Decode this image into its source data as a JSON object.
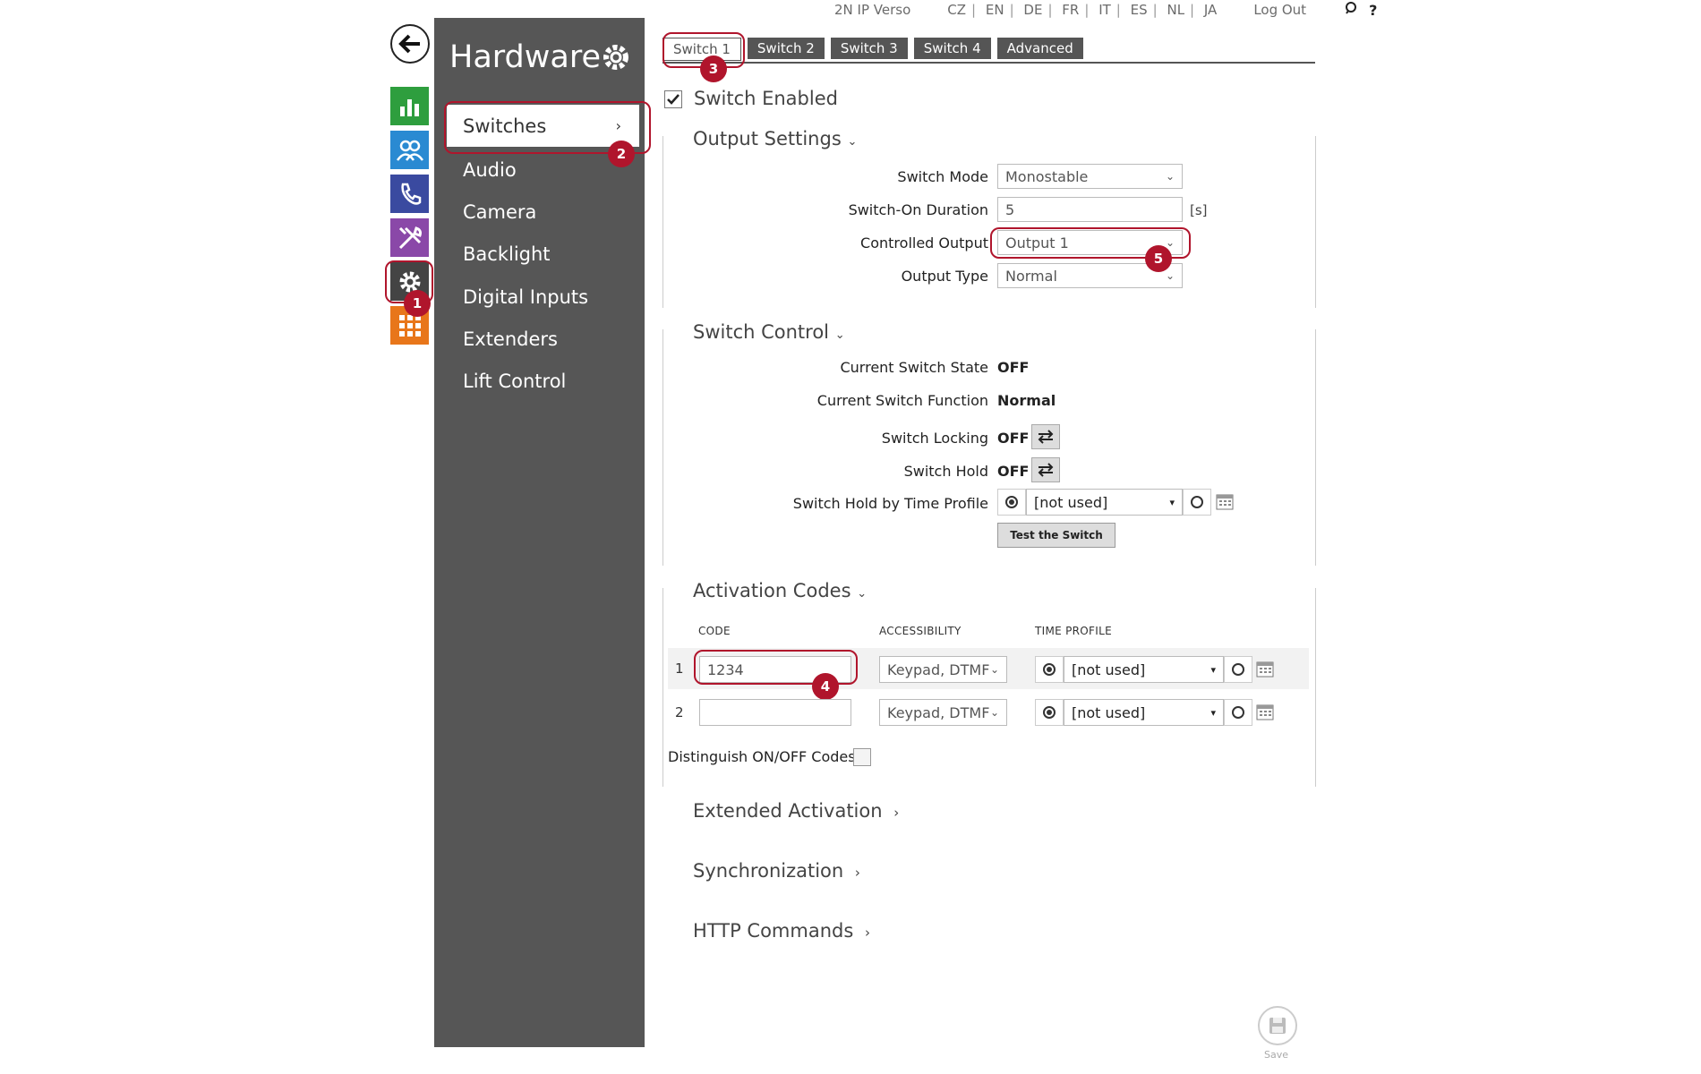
{
  "topbar": {
    "product": "2N IP Verso",
    "languages": [
      "CZ",
      "EN",
      "DE",
      "FR",
      "IT",
      "ES",
      "NL",
      "JA"
    ],
    "logout": "Log Out",
    "search_icon": "search-icon",
    "help": "?"
  },
  "nav_icons": [
    {
      "name": "status-icon",
      "color": "#2e9e3e"
    },
    {
      "name": "directory-icon",
      "color": "#2a8ad2"
    },
    {
      "name": "phone-icon",
      "color": "#3a4aa0"
    },
    {
      "name": "services-icon",
      "color": "#8a48a8"
    },
    {
      "name": "hardware-gear-icon",
      "color": "#444444"
    },
    {
      "name": "system-grid-icon",
      "color": "#e8761a"
    }
  ],
  "sidebar": {
    "title": "Hardware",
    "items": [
      {
        "label": "Switches"
      },
      {
        "label": "Audio"
      },
      {
        "label": "Camera"
      },
      {
        "label": "Backlight"
      },
      {
        "label": "Digital Inputs"
      },
      {
        "label": "Extenders"
      },
      {
        "label": "Lift Control"
      }
    ]
  },
  "tabs": [
    "Switch 1",
    "Switch 2",
    "Switch 3",
    "Switch 4",
    "Advanced"
  ],
  "switch_enabled": "Switch Enabled",
  "output_settings": {
    "title": "Output Settings",
    "mode_label": "Switch Mode",
    "mode_value": "Monostable",
    "duration_label": "Switch-On Duration",
    "duration_value": "5",
    "duration_unit": "[s]",
    "controlled_label": "Controlled Output",
    "controlled_value": "Output 1",
    "type_label": "Output Type",
    "type_value": "Normal"
  },
  "switch_control": {
    "title": "Switch Control",
    "state_label": "Current Switch State",
    "state_value": "OFF",
    "function_label": "Current Switch Function",
    "function_value": "Normal",
    "locking_label": "Switch Locking",
    "locking_value": "OFF",
    "hold_label": "Switch Hold",
    "hold_value": "OFF",
    "hold_profile_label": "Switch Hold by Time Profile",
    "hold_profile_value": "[not used]",
    "test_button": "Test the Switch"
  },
  "activation_codes": {
    "title": "Activation Codes",
    "col_code": "CODE",
    "col_access": "ACCESSIBILITY",
    "col_profile": "TIME PROFILE",
    "rows": [
      {
        "num": "1",
        "code": "1234",
        "access": "Keypad, DTMF",
        "profile": "[not used]"
      },
      {
        "num": "2",
        "code": "",
        "access": "Keypad, DTMF",
        "profile": "[not used]"
      }
    ],
    "distinguish_label": "Distinguish ON/OFF Codes"
  },
  "collapsed_sections": [
    "Extended Activation",
    "Synchronization",
    "HTTP Commands"
  ],
  "save_label": "Save",
  "callouts": [
    "1",
    "2",
    "3",
    "4",
    "5"
  ],
  "accent_color": "#b0152c"
}
